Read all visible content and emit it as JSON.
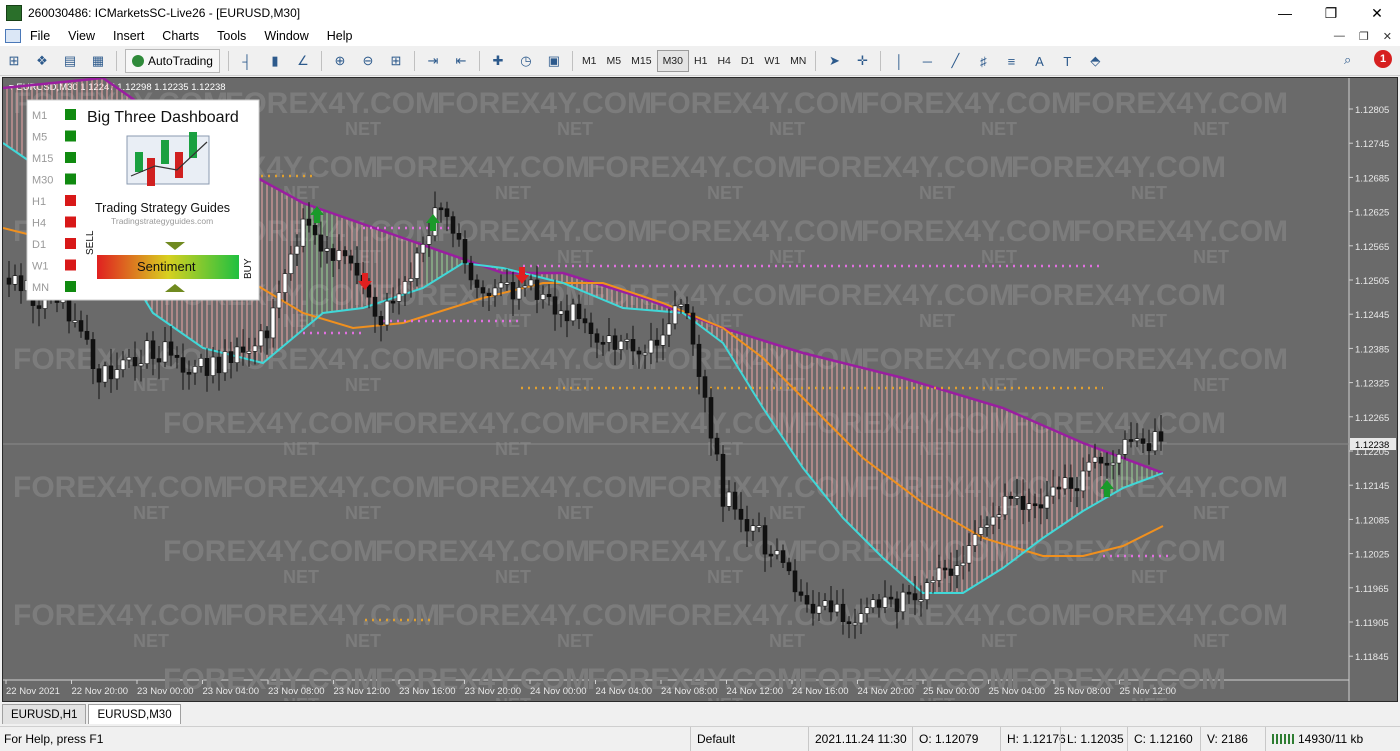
{
  "window": {
    "title": "260030486: ICMarketsSC-Live26 - [EURUSD,M30]",
    "controls": [
      "—",
      "❐",
      "✕"
    ]
  },
  "menu": {
    "items": [
      "File",
      "View",
      "Insert",
      "Charts",
      "Tools",
      "Window",
      "Help"
    ],
    "right": [
      "—",
      "❐",
      "✕"
    ]
  },
  "toolbar": {
    "autotrading_label": "AutoTrading",
    "timeframes": [
      "M1",
      "M5",
      "M15",
      "M30",
      "H1",
      "H4",
      "D1",
      "W1",
      "MN"
    ],
    "active_timeframe": "M30",
    "alert_count": "1"
  },
  "chart": {
    "header": "EURUSD,M30 1.12247 1.12298 1.12235 1.12238",
    "current_price": "1.12238",
    "price_ticks": [
      "1.12805",
      "1.12745",
      "1.12685",
      "1.12625",
      "1.12565",
      "1.12505",
      "1.12445",
      "1.12385",
      "1.12325",
      "1.12265",
      "1.12205",
      "1.12145",
      "1.12085",
      "1.12025",
      "1.11965",
      "1.11905",
      "1.11845"
    ],
    "time_ticks": [
      "22 Nov 2021",
      "22 Nov 20:00",
      "23 Nov 00:00",
      "23 Nov 04:00",
      "23 Nov 08:00",
      "23 Nov 12:00",
      "23 Nov 16:00",
      "23 Nov 20:00",
      "24 Nov 00:00",
      "24 Nov 04:00",
      "24 Nov 08:00",
      "24 Nov 12:00",
      "24 Nov 16:00",
      "24 Nov 20:00",
      "25 Nov 00:00",
      "25 Nov 04:00",
      "25 Nov 08:00",
      "25 Nov 12:00"
    ],
    "watermark": [
      "FOREX4Y.COM",
      "NET"
    ],
    "colors": {
      "background": "#6a6a6a",
      "ma_fast": "#40d8d8",
      "ma_mid": "#f0901e",
      "ma_slow": "#9a1ea0",
      "bull_fill": "#9fd89a",
      "bear_fill": "#f0a8a8",
      "dot_magenta": "#e070e0",
      "dot_orange": "#e0a030"
    }
  },
  "dashboard": {
    "title": "Big Three Dashboard",
    "brand": "Trading Strategy Guides",
    "brand_url": "Tradingstrategyguides.com",
    "timeframes": [
      "M1",
      "M5",
      "M15",
      "M30",
      "H1",
      "H4",
      "D1",
      "W1",
      "MN"
    ],
    "signal_colors": [
      "#108a10",
      "#108a10",
      "#108a10",
      "#108a10",
      "#d81818",
      "#d81818",
      "#d81818",
      "#d81818",
      "#108a10"
    ],
    "sell_label": "SELL",
    "buy_label": "BUY",
    "sentiment_label": "Sentiment"
  },
  "tabs": [
    "EURUSD,H1",
    "EURUSD,M30"
  ],
  "active_tab": "EURUSD,M30",
  "status": {
    "help": "For Help, press F1",
    "profile": "Default",
    "datetime": "2021.11.24 11:30",
    "open": "O: 1.12079",
    "high": "H: 1.12176",
    "low": "L: 1.12035",
    "close": "C: 1.12160",
    "volume": "V: 2186",
    "traffic": "14930/11 kb"
  }
}
